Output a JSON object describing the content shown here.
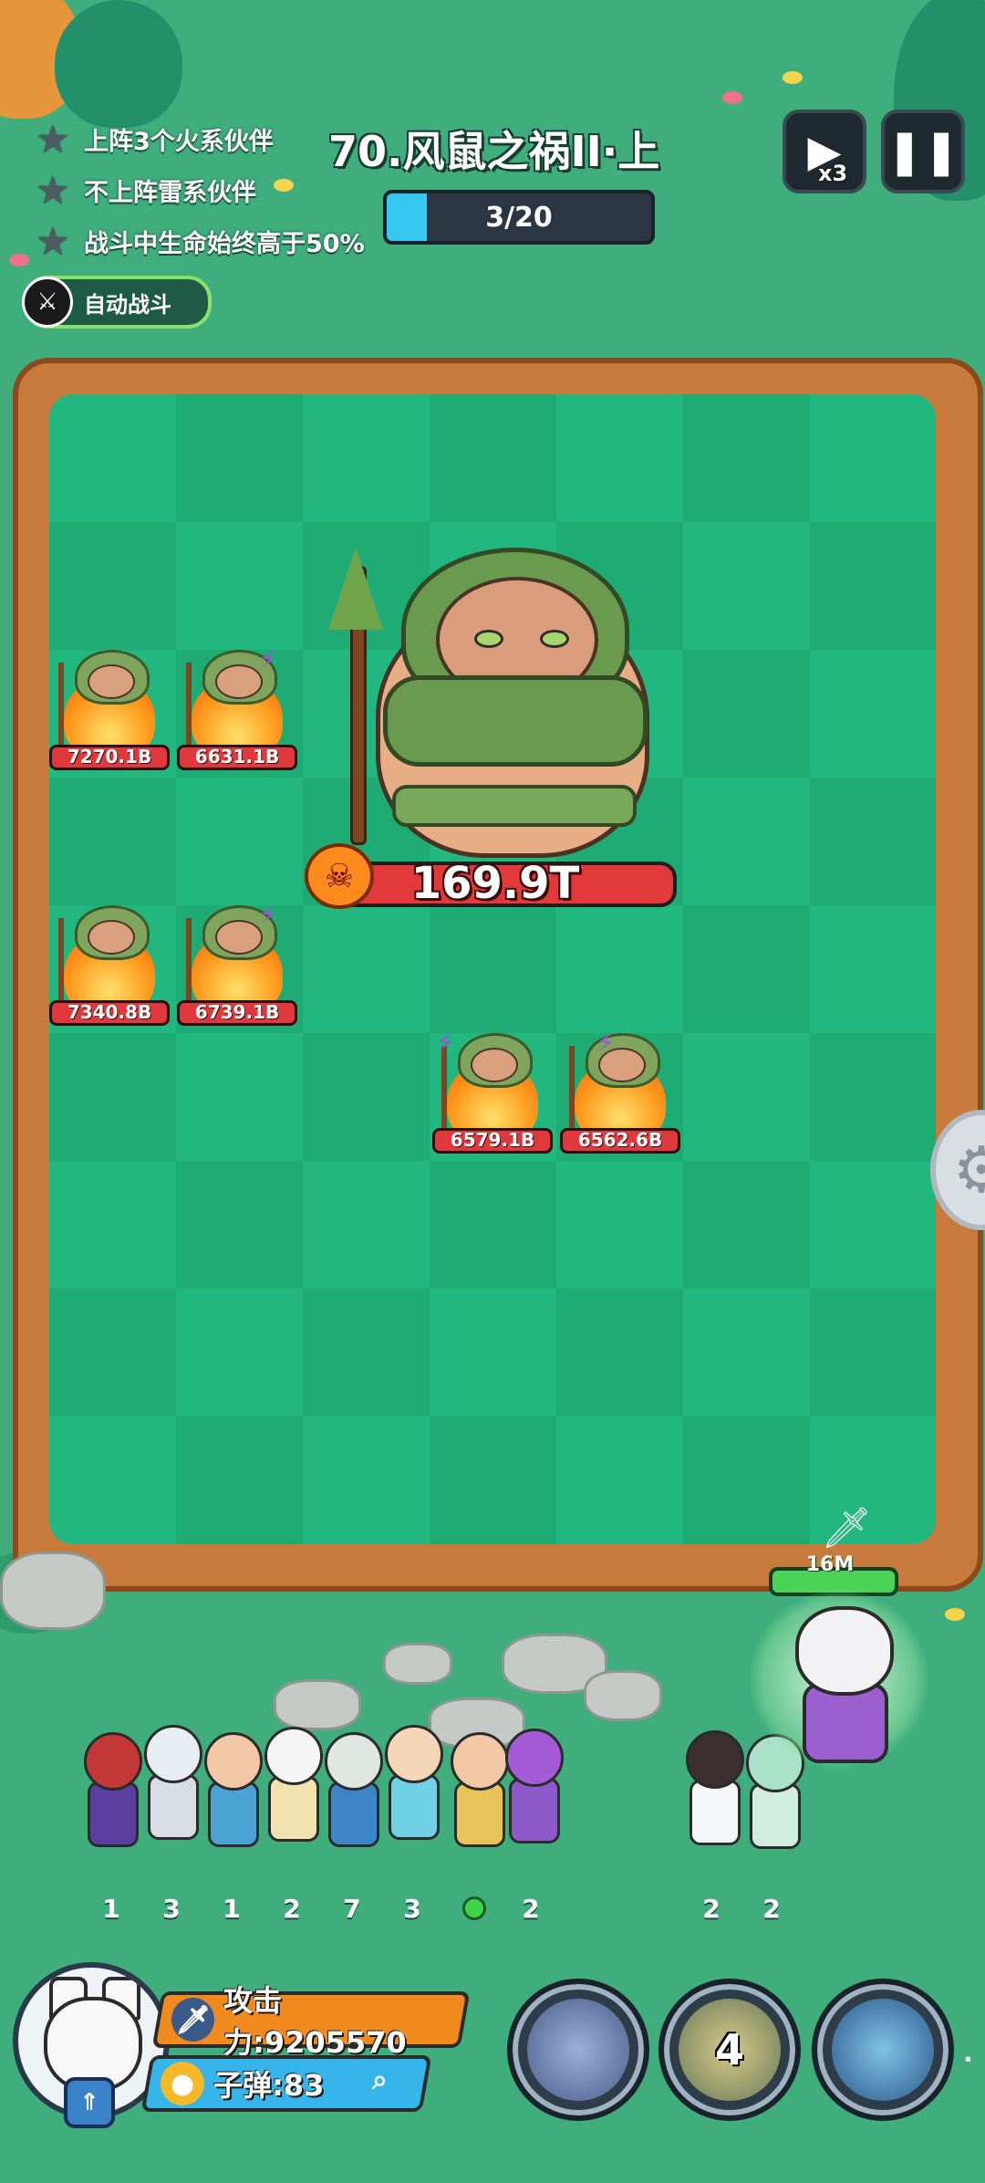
{
  "quests": [
    {
      "text": "上阵3个火系伙伴"
    },
    {
      "text": "不上阵雷系伙伴"
    },
    {
      "text": "战斗中生命始终高于50%"
    }
  ],
  "auto_battle": {
    "label": "自动战斗",
    "icon": "sword-icon"
  },
  "level": {
    "title": "70.风鼠之祸II·上",
    "progress_text": "3/20",
    "progress_fraction": 0.15
  },
  "controls": {
    "speed_label": "x3",
    "speed_icon": "fast-forward-icon",
    "pause_icon": "pause-icon"
  },
  "boss": {
    "hp_text": "169.9T",
    "icon": "demon-skull-icon"
  },
  "minions": [
    {
      "hp": "7270.1B"
    },
    {
      "hp": "6631.1B"
    },
    {
      "hp": "7340.8B"
    },
    {
      "hp": "6739.1B"
    },
    {
      "hp": "6579.1B"
    },
    {
      "hp": "6562.6B"
    }
  ],
  "hero_levels": [
    "1",
    "3",
    "1",
    "2",
    "7",
    "3",
    "2",
    "2",
    "2"
  ],
  "main_hero": {
    "hp_label": "16M",
    "icon": "sword-icon"
  },
  "player": {
    "attack_label": "攻击力:9205570",
    "ammo_label": "子弹:83",
    "avatar": "white-wolf-avatar",
    "zoom_icon": "magnifier-icon"
  },
  "skills": [
    {
      "name": "dragon-skill-1",
      "count": ""
    },
    {
      "name": "dragon-skill-2",
      "count": "4"
    },
    {
      "name": "dragon-skill-3",
      "count": ""
    }
  ],
  "colors": {
    "attack": "#f08a1e",
    "ammo": "#36b5ea",
    "progress": "#36c8f0",
    "hp": "#e23a3a"
  }
}
